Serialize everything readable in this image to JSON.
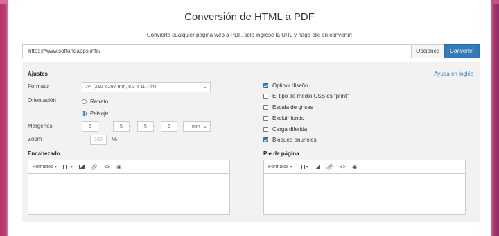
{
  "header": {
    "title": "Conversión de HTML a PDF",
    "subtitle": "Convierta cualquier página web a PDF, sólo ingrese la URL y haga clic en convertir!"
  },
  "url_bar": {
    "value": "https://www.softandapps.info/",
    "options_label": "Opciones",
    "convert_label": "Convertir!"
  },
  "settings": {
    "title": "Ajustes",
    "help_link": "Ayuda en inglés",
    "format_label": "Formato",
    "format_value": "A4 (210 x 297 mm, 8.3 x 11.7 in)",
    "orientation_label": "Orientación",
    "orientation_options": [
      "Retrato",
      "Paisaje"
    ],
    "orientation_selected": "Paisaje",
    "margins_label": "Márgenes",
    "margins": [
      "5",
      "5",
      "5",
      "5"
    ],
    "margin_unit": "mm",
    "zoom_label": "Zoom",
    "zoom_value": "100",
    "zoom_unit": "%"
  },
  "checkboxes": [
    {
      "label": "Optimir diseño",
      "checked": true
    },
    {
      "label": "El tipo de medio CSS es \"print\"",
      "checked": false
    },
    {
      "label": "Escala de grises",
      "checked": false
    },
    {
      "label": "Excluir fondo",
      "checked": false
    },
    {
      "label": "Carga diferida",
      "checked": false
    },
    {
      "label": "Bloquea anuncios",
      "checked": true
    }
  ],
  "header_editor": {
    "title": "Encabezado",
    "formats_label": "Formatos"
  },
  "footer_editor": {
    "title": "Pie de página",
    "formats_label": "Formatos"
  },
  "colors": {
    "accent": "#337ab7",
    "panel_bg": "#f2f2f2"
  },
  "icons": [
    "table-icon",
    "image-icon",
    "link-icon",
    "code-icon",
    "preview-icon"
  ]
}
